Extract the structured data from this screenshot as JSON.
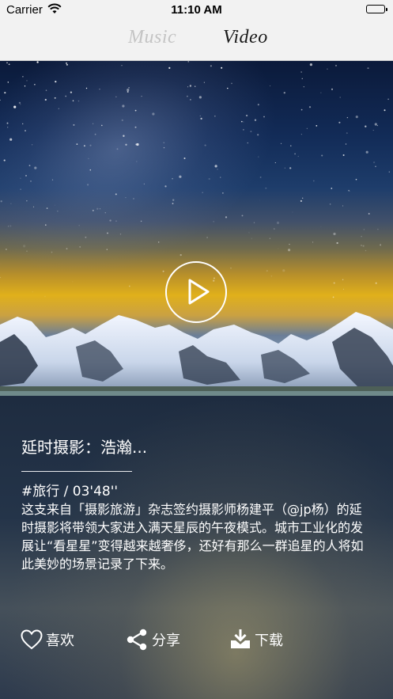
{
  "status_bar": {
    "carrier": "Carrier",
    "time": "11:10 AM"
  },
  "tabs": [
    {
      "label": "Music",
      "active": false
    },
    {
      "label": "Video",
      "active": true
    }
  ],
  "video": {
    "title": "延时摄影：浩瀚...",
    "meta": "#旅行  /  03'48''",
    "description": "这支来自「摄影旅游」杂志签约摄影师杨建平（@jp杨）的延时摄影将带领大家进入满天星辰的午夜模式。城市工业化的发展让“看星星”变得越来越奢侈，还好有那么一群追星的人将如此美妙的场景记录了下来。"
  },
  "actions": {
    "like_label": "喜欢",
    "share_label": "分享",
    "download_label": "下载"
  },
  "icons": {
    "wifi": "wifi-icon",
    "battery": "battery-icon",
    "play": "play-icon",
    "heart": "heart-icon",
    "share": "share-icon",
    "download": "download-icon"
  },
  "colors": {
    "header_bg": "#f2f2f2",
    "active_tab": "#1a1a1a",
    "inactive_tab": "#c4c4c4",
    "text_on_dark": "#ffffff"
  }
}
